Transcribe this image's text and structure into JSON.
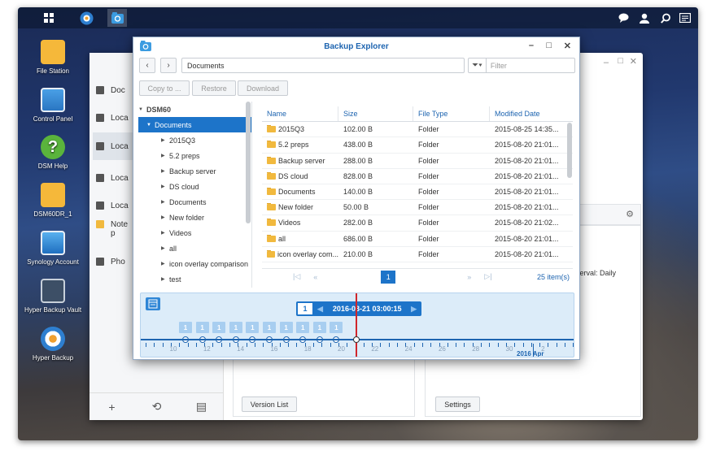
{
  "desktop": {
    "icons": [
      {
        "label": "File Station",
        "icon": "folder-icon",
        "color": "#f5b83a"
      },
      {
        "label": "Control Panel",
        "icon": "control-panel-icon",
        "color": "#3b8fd6"
      },
      {
        "label": "DSM Help",
        "icon": "help-icon",
        "color": "#5ab43c"
      },
      {
        "label": "DSM60DR_1",
        "icon": "folder-icon",
        "color": "#f5b83a"
      },
      {
        "label": "Synology Account",
        "icon": "account-icon",
        "color": "#2d8bd6"
      },
      {
        "label": "Hyper Backup Vault",
        "icon": "vault-icon",
        "color": "#3d4f66"
      },
      {
        "label": "Hyper Backup",
        "icon": "hyper-backup-icon",
        "color": "#2e7fd0"
      }
    ]
  },
  "taskbar": {
    "icons": [
      "main-menu-icon",
      "hyper-backup-icon",
      "backup-explorer-icon"
    ],
    "right_icons": [
      "chat-icon",
      "user-icon",
      "search-icon",
      "widgets-icon"
    ]
  },
  "back_window": {
    "sidebar_items": [
      "Doc",
      "Loca",
      "Loca",
      "Loca",
      "Loca",
      "Note",
      "p",
      "Pho"
    ],
    "right_text": "terval: Daily",
    "version_list_label": "Version List",
    "settings_label": "Settings"
  },
  "explorer": {
    "title": "Backup Explorer",
    "path": "Documents",
    "filter_placeholder": "Filter",
    "buttons": {
      "copy": "Copy to ...",
      "restore": "Restore",
      "download": "Download"
    },
    "tree": {
      "root": "DSM60",
      "selected": "Documents",
      "children": [
        "2015Q3",
        "5.2 preps",
        "Backup server",
        "DS cloud",
        "Documents",
        "New folder",
        "Videos",
        "all",
        "icon overlay comparison",
        "test"
      ]
    },
    "columns": [
      "Name",
      "Size",
      "File Type",
      "Modified Date"
    ],
    "rows": [
      {
        "name": "2015Q3",
        "size": "102.00 B",
        "type": "Folder",
        "date": "2015-08-25 14:35..."
      },
      {
        "name": "5.2 preps",
        "size": "438.00 B",
        "type": "Folder",
        "date": "2015-08-20 21:01..."
      },
      {
        "name": "Backup server",
        "size": "288.00 B",
        "type": "Folder",
        "date": "2015-08-20 21:01..."
      },
      {
        "name": "DS cloud",
        "size": "828.00 B",
        "type": "Folder",
        "date": "2015-08-20 21:01..."
      },
      {
        "name": "Documents",
        "size": "140.00 B",
        "type": "Folder",
        "date": "2015-08-20 21:01..."
      },
      {
        "name": "New folder",
        "size": "50.00 B",
        "type": "Folder",
        "date": "2015-08-20 21:01..."
      },
      {
        "name": "Videos",
        "size": "282.00 B",
        "type": "Folder",
        "date": "2015-08-20 21:02..."
      },
      {
        "name": "all",
        "size": "686.00 B",
        "type": "Folder",
        "date": "2015-08-20 21:01..."
      },
      {
        "name": "icon overlay com...",
        "size": "210.00 B",
        "type": "Folder",
        "date": "2015-08-20 21:01..."
      }
    ],
    "pager": {
      "page": "1",
      "count": "25 item(s)"
    },
    "timeline": {
      "version_count": "1",
      "current": "2016-03-21 03:00:15",
      "month_label": "2016 Apr",
      "day_labels": [
        "10",
        "12",
        "14",
        "16",
        "18",
        "20",
        "22",
        "24",
        "26",
        "28",
        "30",
        "2"
      ],
      "badges": [
        "1",
        "1",
        "1",
        "1",
        "1",
        "1",
        "1",
        "1",
        "1",
        "1"
      ]
    }
  }
}
